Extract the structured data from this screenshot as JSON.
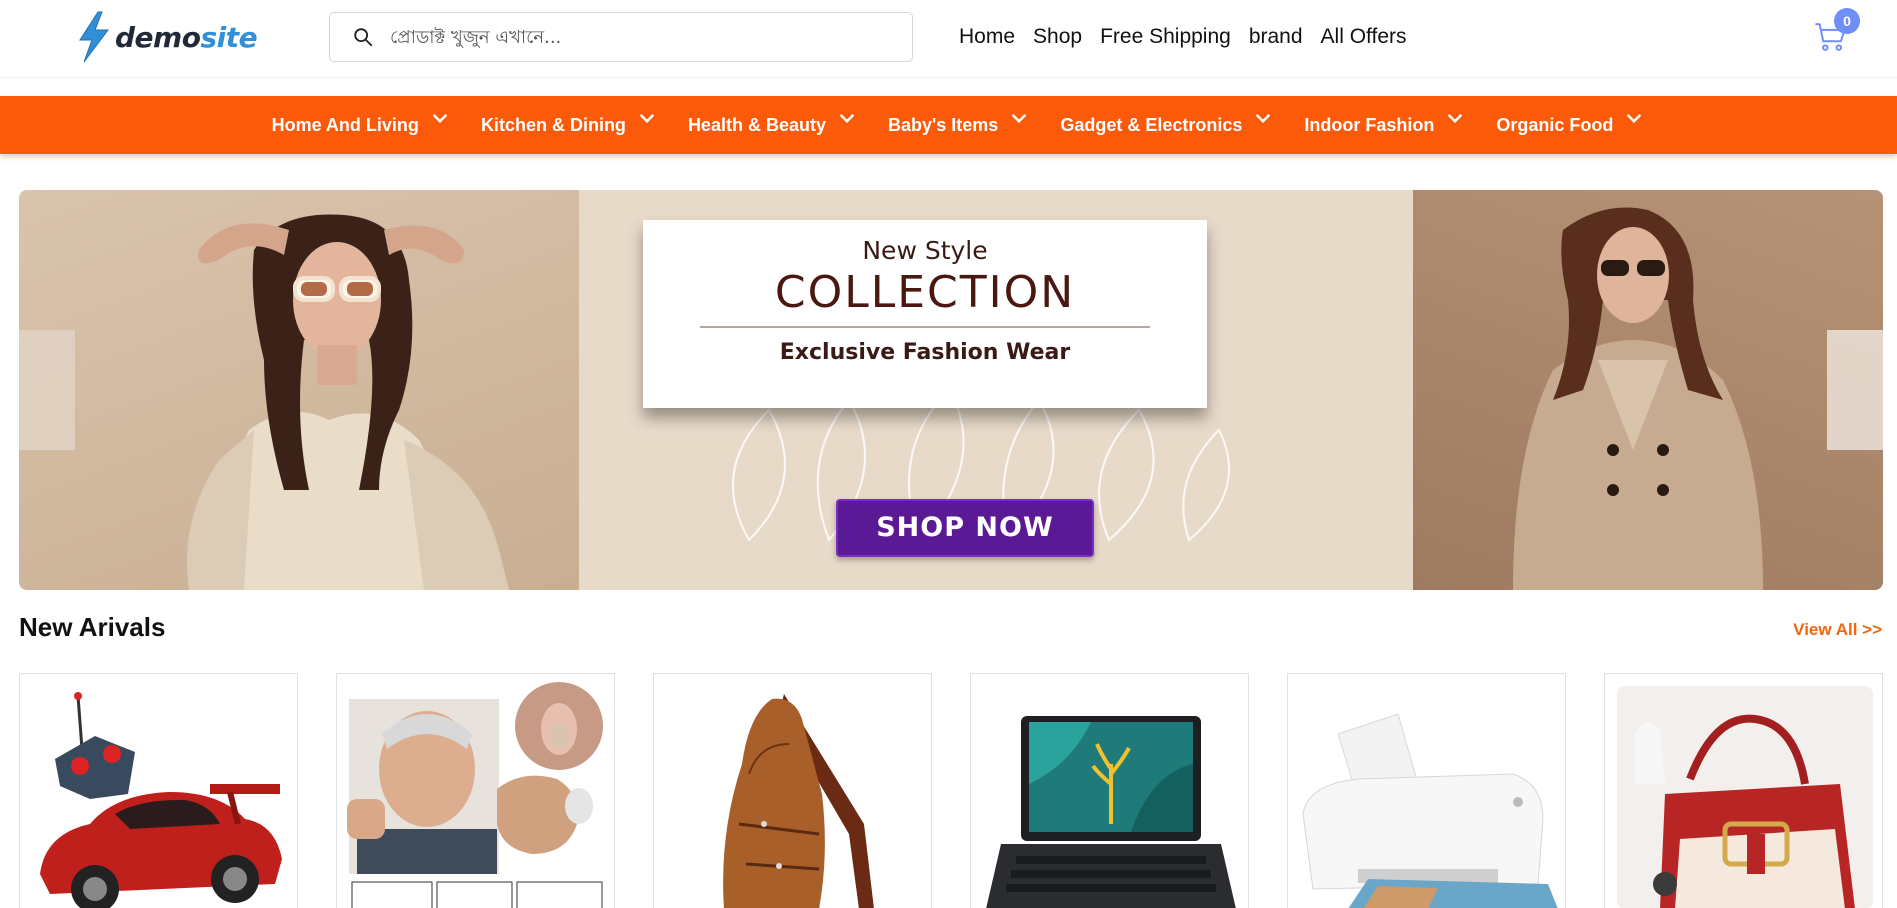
{
  "header": {
    "logo_demo": "demo",
    "logo_site": "site",
    "search_placeholder": "প্রোডাক্ট খুজুন এখানে...",
    "nav": [
      "Home",
      "Shop",
      "Free Shipping",
      "brand",
      "All Offers"
    ],
    "cart_count": "0"
  },
  "categories": [
    "Home And Living",
    "Kitchen & Dining",
    "Health & Beauty",
    "Baby's Items",
    "Gadget & Electronics",
    "Indoor Fashion",
    "Organic Food"
  ],
  "hero": {
    "subtitle": "New Style",
    "title": "COLLECTION",
    "tagline": "Exclusive Fashion Wear",
    "cta": "SHOP NOW"
  },
  "section": {
    "title": "New Arivals",
    "view_all": "View All >>"
  },
  "products": [
    {
      "icon": "rc-car-icon"
    },
    {
      "icon": "hearing-aid-icon"
    },
    {
      "icon": "leather-sling-bag-icon"
    },
    {
      "icon": "laptop-icon"
    },
    {
      "icon": "printer-icon"
    },
    {
      "icon": "handbag-icon"
    }
  ],
  "colors": {
    "accent": "#fa5a0a",
    "cta": "#5a1a96",
    "badge": "#6f8ef7",
    "view_all": "#f0650e"
  }
}
